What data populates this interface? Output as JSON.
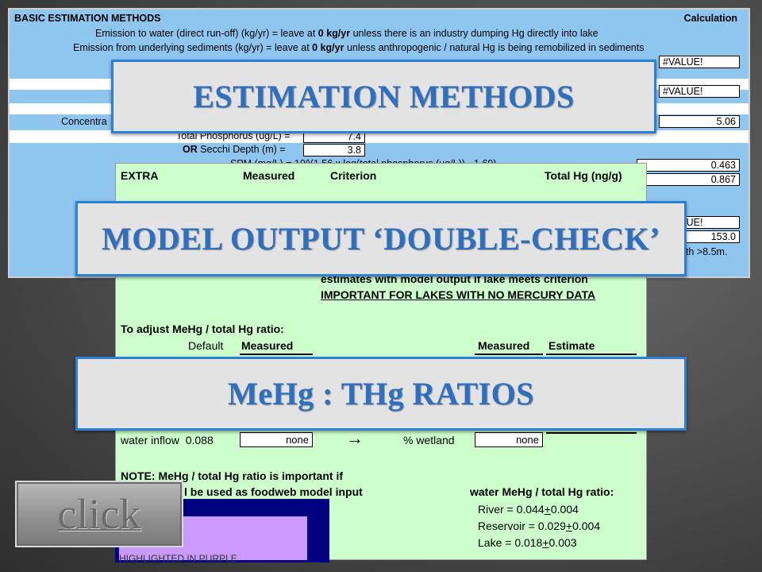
{
  "top_sheet": {
    "title": "BASIC ESTIMATION METHODS",
    "calc_header": "Calculation",
    "line1_prefix": "Emission to water (direct run-off) (kg/yr) = leave at ",
    "line1_bold": "0 kg/yr",
    "line1_suffix": " unless there is an industry dumping Hg directly into lake",
    "line2_prefix": "Emission from underlying sediments (kg/yr) = leave at ",
    "line2_bold": "0 kg/yr",
    "line2_suffix": " unless anthropogenic / natural Hg is being remobilized in sediments",
    "concentration_label": "Concentra",
    "phosphorus_label": "Total Phosphorus (ug/L) =",
    "phosphorus_value": "7.4",
    "secchi_or": "OR",
    "secchi_label": " Secchi Depth (m) =",
    "secchi_value": "3.8",
    "spm_formula": "SPM (mg/L) = 10^(1.56 x log(total phosphorus (ug/L)) - 1.69)",
    "calc_values": [
      "#VALUE!",
      "#VALUE!",
      "5.06",
      "0.463",
      "0.867",
      "#VALUE!",
      "153.0"
    ],
    "note_fragment": "pth >8.5m."
  },
  "bottom_sheet": {
    "headers": {
      "extra": "EXTRA",
      "measured": "Measured",
      "criterion": "Criterion",
      "total_hg": "Total Hg (ng/g)"
    },
    "compare_line1": "estimates with model output if lake meets criterion",
    "compare_line2": "IMPORTANT FOR LAKES WITH NO MERCURY DATA",
    "adjust_title": "To adjust MeHg / total Hg ratio:",
    "default_label": "Default",
    "measured_label": "Measured",
    "measured_label2": "Measured",
    "estimate_label": "Estimate",
    "water_inflow_label": "water inflow",
    "water_inflow_value": "0.088",
    "inflow_measured": "none",
    "arrow": "→",
    "wetland_label": "% wetland",
    "wetland_value": "none",
    "note_line1": "NOTE:  MeHg / total Hg ratio is important if",
    "note_line2": "l be used as foodweb model input",
    "ratio_title": "water MeHg / total Hg ratio:",
    "ratios": [
      {
        "label": "River = 0.044",
        "pm": "+",
        "err": "0.004"
      },
      {
        "label": "Reservoir = 0.029",
        "pm": "+",
        "err": "0.004"
      },
      {
        "label": "Lake = 0.018",
        "pm": "+",
        "err": "0.003"
      }
    ],
    "purple_note": "HIGHLIGHTED IN PURPLE"
  },
  "banners": {
    "estimation": "ESTIMATION METHODS",
    "double_check": "MODEL OUTPUT ‘DOUBLE-CHECK’",
    "ratios": "MeHg : THg RATIOS"
  },
  "click_button": "click",
  "colors": {
    "sheet_blue": "#8fc6f0",
    "sheet_green": "#ccffcc",
    "banner_text": "#2e6fc0",
    "banner_border": "#2e7fd6",
    "purple_fill": "#cc99ff",
    "navy": "#000080"
  }
}
